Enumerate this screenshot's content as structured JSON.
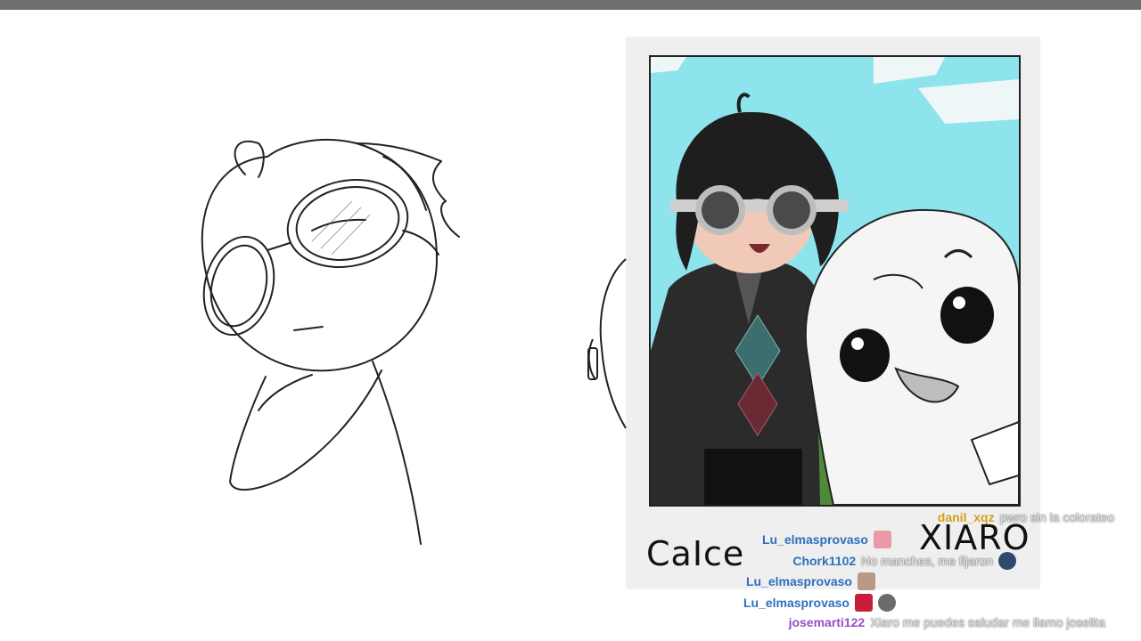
{
  "polaroid": {
    "left_name": "CaIce",
    "right_name": "XIARO"
  },
  "chat": {
    "messages": [
      {
        "user": "danil_xqz",
        "user_color": "#d4a017",
        "text": "pwro sin la colorateo",
        "emotes": []
      },
      {
        "user": "Lu_elmasprovaso",
        "user_color": "#2f6fbe",
        "text": "",
        "emotes": [
          "heart-emote"
        ]
      },
      {
        "user": "Chork1102",
        "user_color": "#2f6fbe",
        "text": "No manches, me fijaron",
        "emotes": [
          "badge-emote"
        ]
      },
      {
        "user": "Lu_elmasprovaso",
        "user_color": "#2f6fbe",
        "text": "",
        "emotes": [
          "face-emote"
        ]
      },
      {
        "user": "Lu_elmasprovaso",
        "user_color": "#2f6fbe",
        "text": "",
        "emotes": [
          "red-emote",
          "creature-emote"
        ]
      },
      {
        "user": "josemarti122",
        "user_color": "#9b4dca",
        "text": "Xiaro me puedes saludar me llamo joselita",
        "emotes": []
      }
    ]
  }
}
